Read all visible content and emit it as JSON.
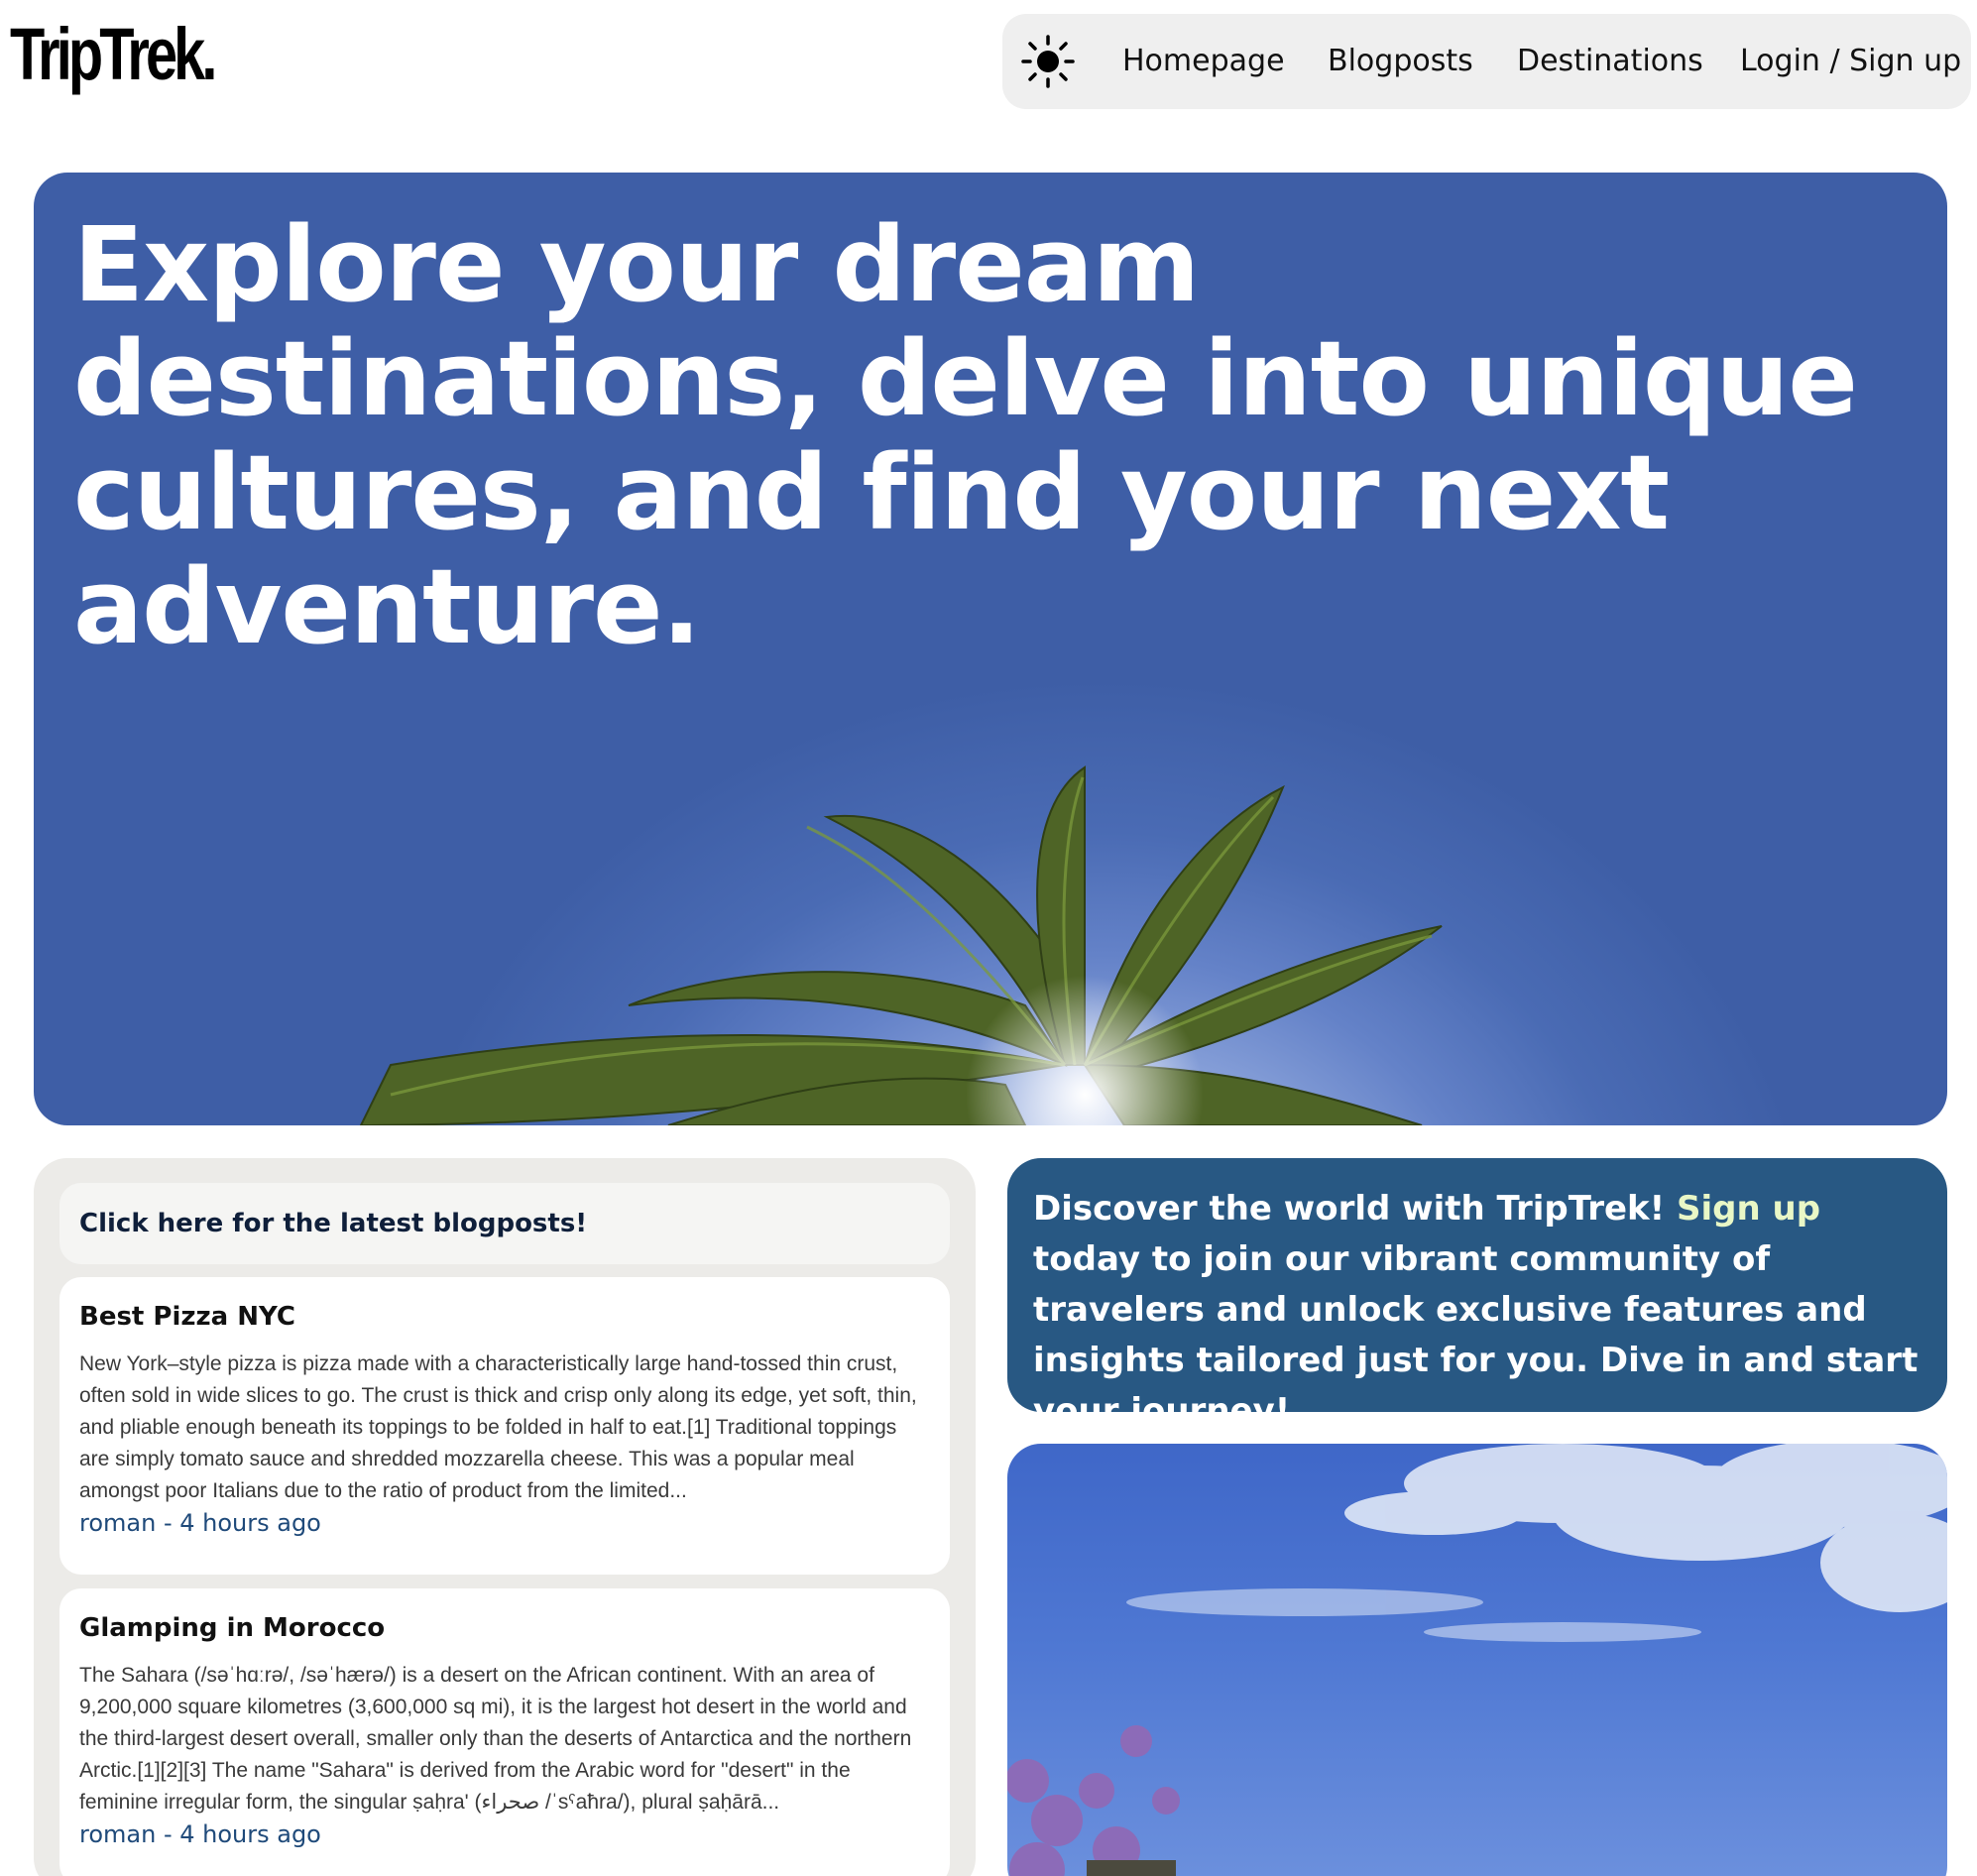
{
  "header": {
    "logo": "TripTrek.",
    "theme_toggle_icon": "sun-icon",
    "nav": {
      "homepage": "Homepage",
      "blogposts": "Blogposts",
      "destinations": "Destinations",
      "login": "Login / Sign up"
    }
  },
  "hero": {
    "headline": "Explore your dream destinations, delve into unique cultures, and find your next adventure."
  },
  "blog": {
    "cta": "Click here for the latest blogposts!",
    "posts": [
      {
        "title": "Best Pizza NYC",
        "body": "New York–style pizza is pizza made with a characteristically large hand-tossed thin crust, often sold in wide slices to go. The crust is thick and crisp only along its edge, yet soft, thin, and pliable enough beneath its toppings to be folded in half to eat.[1] Traditional toppings are simply tomato sauce and shredded mozzarella cheese. This was a popular meal amongst poor Italians due to the ratio of product from the limited...",
        "meta": "roman - 4 hours ago"
      },
      {
        "title": "Glamping in Morocco",
        "body": "The Sahara (/səˈhɑːrə/, /səˈhærə/) is a desert on the African continent. With an area of 9,200,000 square kilometres (3,600,000 sq mi), it is the largest hot desert in the world and the third-largest desert overall, smaller only than the deserts of Antarctica and the northern Arctic.[1][2][3] The name \"Sahara\" is derived from the Arabic word for \"desert\" in the feminine irregular form, the singular ṣaḥra' (صحراء /ˈsˤaħra/), plural ṣaḥārā...",
        "meta": "roman - 4 hours ago"
      }
    ]
  },
  "promo": {
    "before": "Discover the world with TripTrek! ",
    "link": "Sign up",
    "after": " today to join our vibrant community of travelers and unlock exclusive features and insights tailored just for you. Dive in and start your journey!"
  },
  "colors": {
    "promo_bg": "#285883",
    "signup_link": "#e9f7c6",
    "meta_text": "#1f4a7a",
    "nav_bg": "#efefef",
    "panel_bg": "#ecebe8"
  }
}
